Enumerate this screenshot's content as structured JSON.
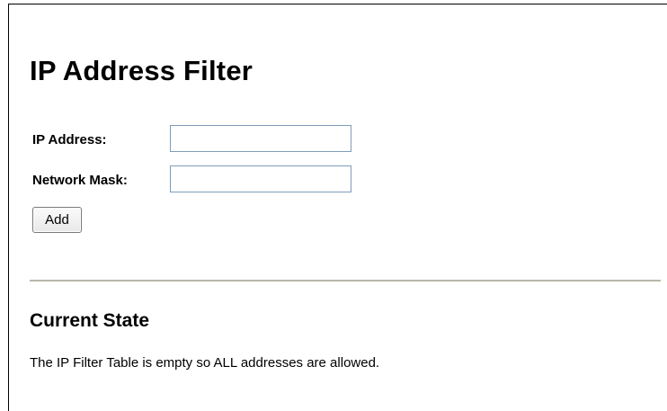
{
  "page": {
    "title": "IP Address Filter"
  },
  "form": {
    "ip_address_label": "IP Address:",
    "ip_address_value": "",
    "network_mask_label": "Network Mask:",
    "network_mask_value": "",
    "add_button_label": "Add"
  },
  "current_state": {
    "heading": "Current State",
    "message": "The IP Filter Table is empty so ALL addresses are allowed."
  }
}
